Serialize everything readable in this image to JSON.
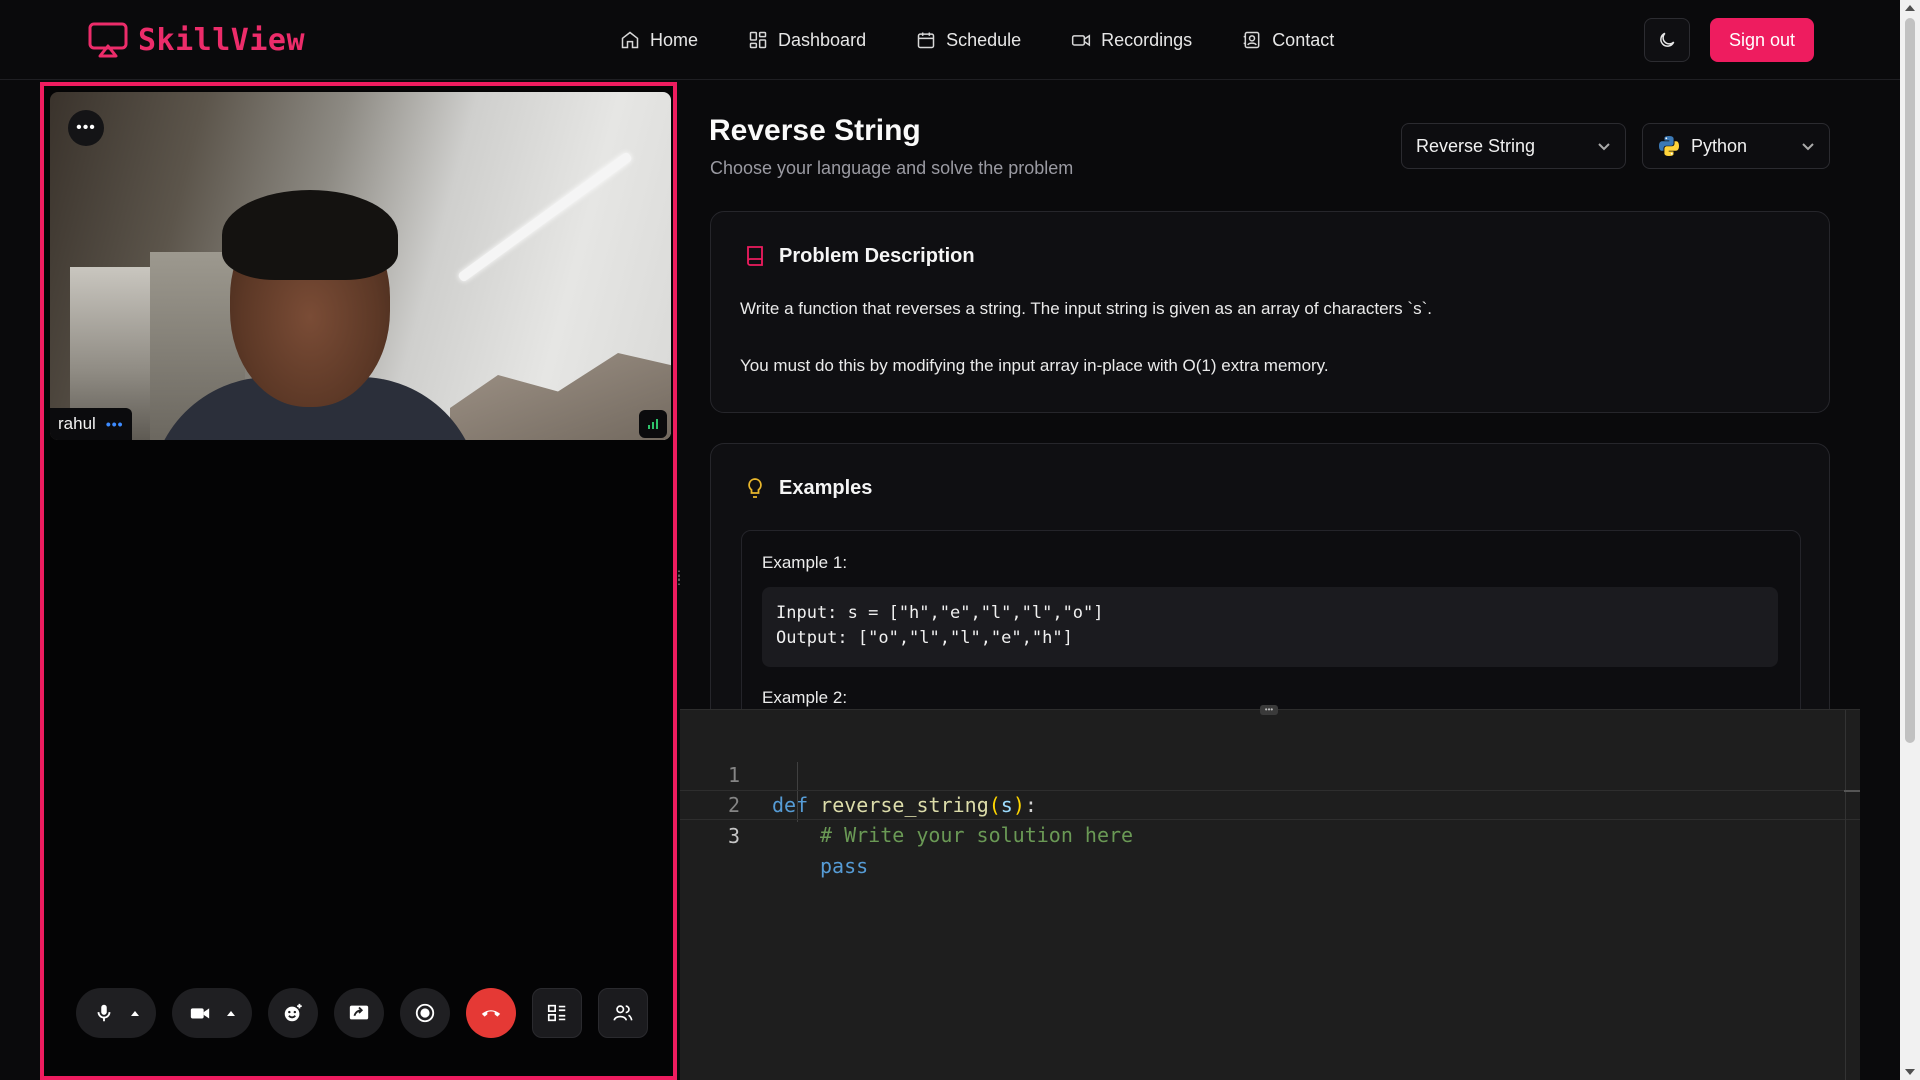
{
  "app": {
    "name": "SkillView",
    "brand_color": "#ee1c5f"
  },
  "nav": {
    "links": [
      {
        "label": "Home",
        "icon": "home-icon"
      },
      {
        "label": "Dashboard",
        "icon": "dashboard-icon"
      },
      {
        "label": "Schedule",
        "icon": "calendar-icon"
      },
      {
        "label": "Recordings",
        "icon": "video-camera-icon"
      },
      {
        "label": "Contact",
        "icon": "contact-icon"
      }
    ],
    "theme_toggle_icon": "moon-icon",
    "signout_label": "Sign out"
  },
  "video": {
    "participant_name": "rahul",
    "menu_icon": "more-dots-icon",
    "controls": [
      {
        "name": "microphone",
        "icon": "microphone-icon"
      },
      {
        "name": "camera",
        "icon": "camera-icon"
      },
      {
        "name": "reactions",
        "icon": "emoji-icon"
      },
      {
        "name": "screen-share",
        "icon": "screen-share-icon"
      },
      {
        "name": "record",
        "icon": "record-icon"
      },
      {
        "name": "leave",
        "icon": "phone-hangup-icon",
        "color": "#e53935"
      },
      {
        "name": "layout",
        "icon": "layout-icon"
      },
      {
        "name": "participants",
        "icon": "participants-icon"
      }
    ]
  },
  "problem": {
    "title": "Reverse String",
    "subtitle": "Choose your language and solve the problem",
    "problem_select_value": "Reverse String",
    "language_select_value": "Python",
    "description": {
      "heading": "Problem Description",
      "paragraphs": [
        "Write a function that reverses a string. The input string is given as an array of characters `s`.",
        "You must do this by modifying the input array in-place with O(1) extra memory."
      ]
    },
    "examples": {
      "heading": "Examples",
      "items": [
        {
          "label": "Example 1:",
          "input": "Input: s = [\"h\",\"e\",\"l\",\"l\",\"o\"]",
          "output": "Output: [\"o\",\"l\",\"l\",\"e\",\"h\"]"
        },
        {
          "label": "Example 2:"
        }
      ]
    }
  },
  "editor": {
    "lines": [
      {
        "number": "1",
        "kw": "def",
        "fn": "reverse_string",
        "open": "(",
        "param": "s",
        "close": ")",
        "colon": ":"
      },
      {
        "number": "2",
        "comment": "# Write your solution here"
      },
      {
        "number": "3",
        "kw": "pass"
      }
    ]
  }
}
